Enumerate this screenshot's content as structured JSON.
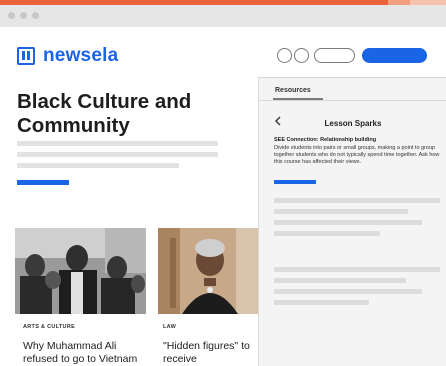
{
  "logo": {
    "text": "newsela",
    "brand_color": "#1a64e6"
  },
  "article": {
    "title": "Black Culture and Community"
  },
  "cards": [
    {
      "tag": "ARTS & CULTURE",
      "title": "Why Muhammad Ali refused to go to Vietnam"
    },
    {
      "tag": "LAW",
      "title": "\"Hidden figures\" to receive Congressional"
    }
  ],
  "panel": {
    "tab": "Resources",
    "title": "Lesson Sparks",
    "subtitle": "SEE Connection: Relationship building",
    "body": "Divide students into pairs or small groups, making a point to group together students who do not typically spend time together. Ask how this course has affected their views."
  },
  "colors": {
    "accent": "#e8623a",
    "primary": "#1a64e6",
    "placeholder": "#e2e2e2"
  },
  "icons": {
    "logo": "newsela-book-icon",
    "back": "chevron-left-icon"
  }
}
